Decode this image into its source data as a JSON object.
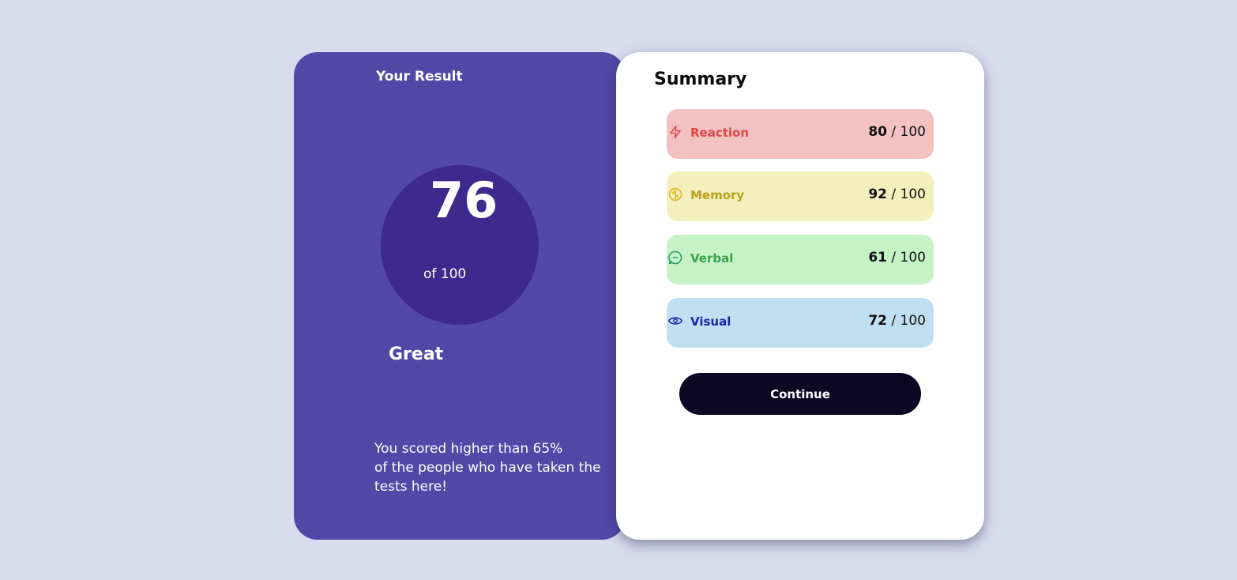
{
  "result": {
    "title": "Your Result",
    "score": "76",
    "out_of": "of 100",
    "rating": "Great",
    "description_line1": "You scored higher than 65%",
    "description_line2": "of the people who have taken the",
    "description_line3": "tests here!"
  },
  "summary": {
    "title": "Summary",
    "items": [
      {
        "label": "Reaction",
        "score": "80",
        "max": " / 100",
        "icon": "lightning-icon",
        "color": "#e04545",
        "bg": "#f2c1c1"
      },
      {
        "label": "Memory",
        "score": "92",
        "max": " / 100",
        "icon": "brain-icon",
        "color": "#b9a21e",
        "bg": "#f5efbd"
      },
      {
        "label": "Verbal",
        "score": "61",
        "max": " / 100",
        "icon": "chat-bubble-icon",
        "color": "#3aa34e",
        "bg": "#c5f3c5"
      },
      {
        "label": "Visual",
        "score": "72",
        "max": " / 100",
        "icon": "eye-icon",
        "color": "#1f23a8",
        "bg": "#c0dff0"
      }
    ],
    "continue_label": "Continue"
  },
  "colors": {
    "page_bg": "#d9dbef",
    "left_card": "#5347a8",
    "score_circle": "#3d2a8c",
    "button": "#0c0722"
  }
}
